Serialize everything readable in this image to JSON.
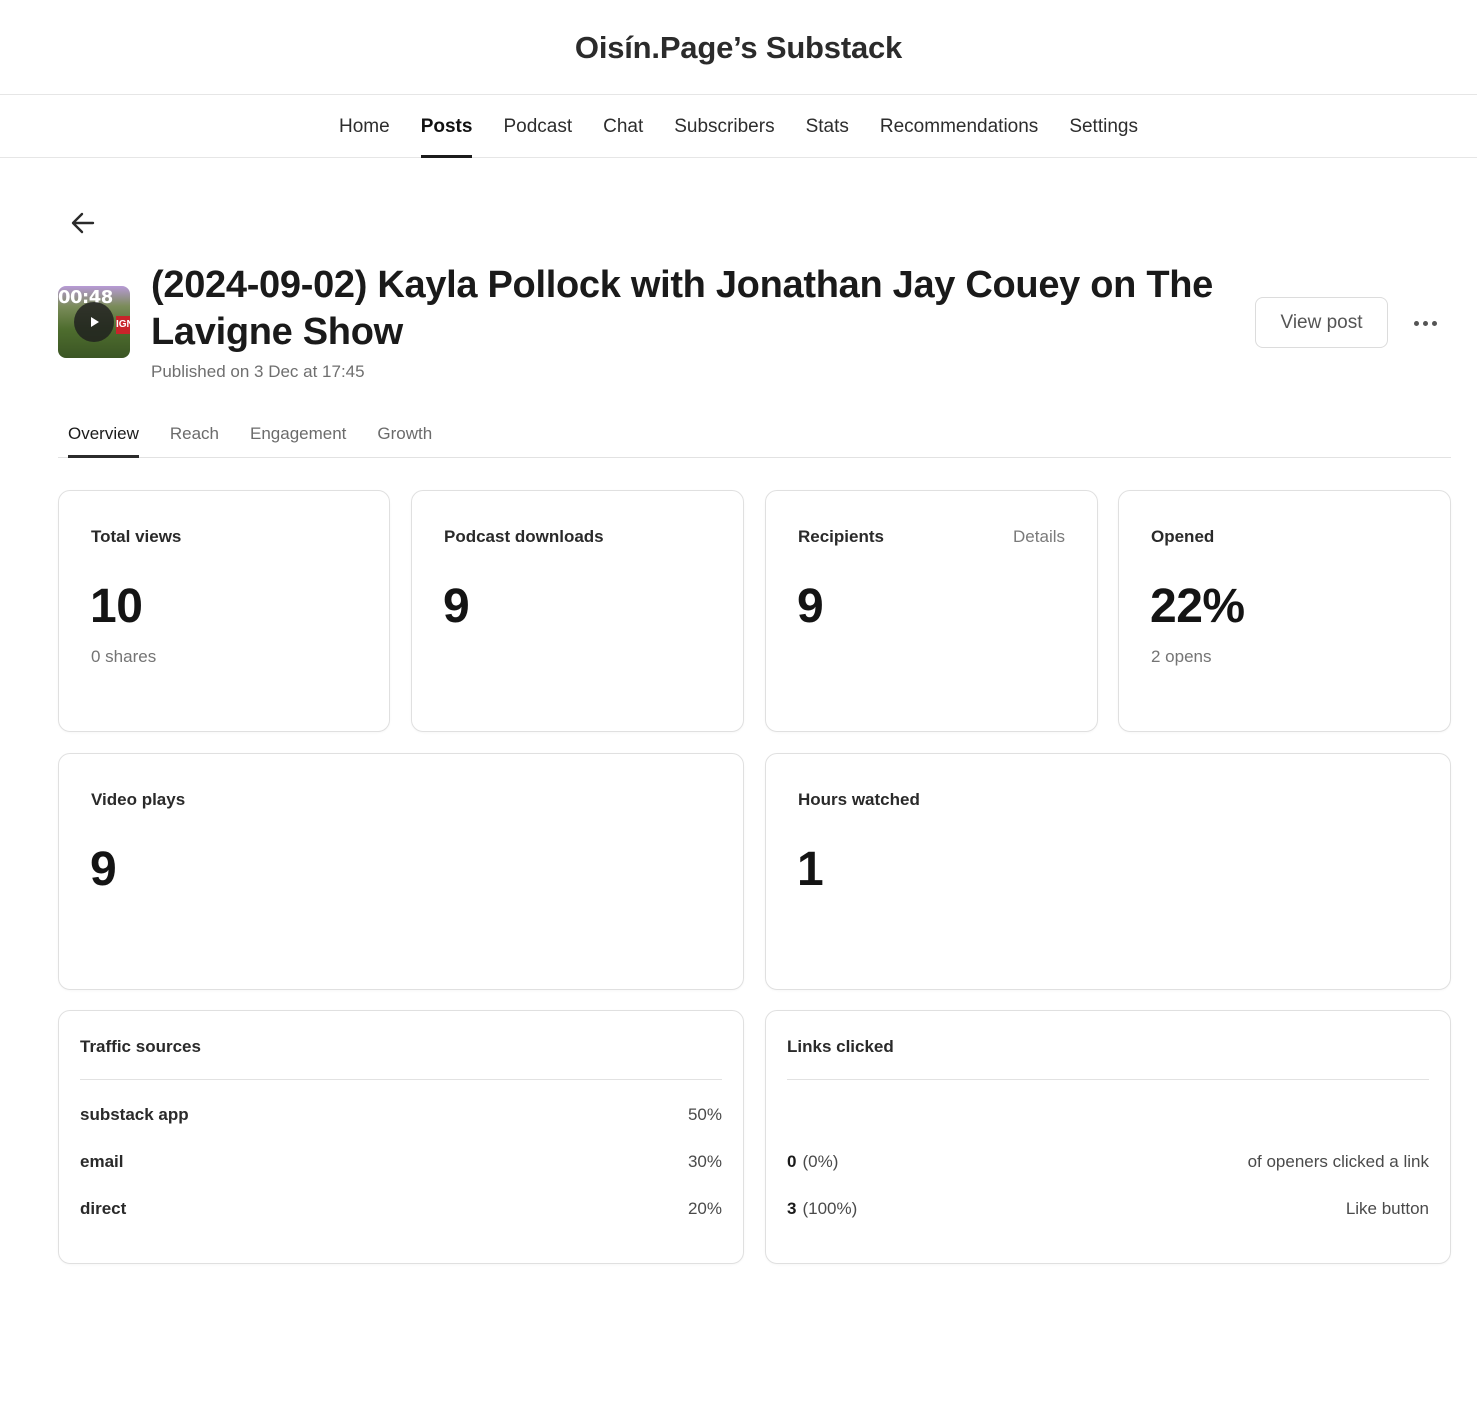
{
  "site": {
    "title": "Oisín.Page’s Substack"
  },
  "nav": {
    "items": [
      {
        "label": "Home"
      },
      {
        "label": "Posts"
      },
      {
        "label": "Podcast"
      },
      {
        "label": "Chat"
      },
      {
        "label": "Subscribers"
      },
      {
        "label": "Stats"
      },
      {
        "label": "Recommendations"
      },
      {
        "label": "Settings"
      }
    ],
    "active": "Posts"
  },
  "post": {
    "thumbnail_time": "00:48",
    "thumbnail_badge": "IGN",
    "title": "(2024-09-02) Kayla Pollock with Jonathan Jay Couey on The Lavigne Show",
    "published": "Published on 3 Dec at 17:45",
    "view_post_label": "View post"
  },
  "tabs": {
    "items": [
      {
        "label": "Overview"
      },
      {
        "label": "Reach"
      },
      {
        "label": "Engagement"
      },
      {
        "label": "Growth"
      }
    ],
    "active": "Overview"
  },
  "stats": {
    "total_views": {
      "label": "Total views",
      "value": "10",
      "sub": "0 shares"
    },
    "podcast_downloads": {
      "label": "Podcast downloads",
      "value": "9"
    },
    "recipients": {
      "label": "Recipients",
      "value": "9",
      "link": "Details"
    },
    "opened": {
      "label": "Opened",
      "value": "22%",
      "sub": "2 opens"
    },
    "video_plays": {
      "label": "Video plays",
      "value": "9"
    },
    "hours_watched": {
      "label": "Hours watched",
      "value": "1"
    }
  },
  "traffic_sources": {
    "title": "Traffic sources",
    "rows": [
      {
        "name": "substack app",
        "value": "50%"
      },
      {
        "name": "email",
        "value": "30%"
      },
      {
        "name": "direct",
        "value": "20%"
      }
    ]
  },
  "links_clicked": {
    "title": "Links clicked",
    "rows": [
      {
        "count": "0",
        "pct": "(0%)",
        "desc": "of openers clicked a link"
      },
      {
        "count": "3",
        "pct": "(100%)",
        "desc": "Like button"
      }
    ]
  },
  "colors": {
    "text": "#1b1b1b",
    "muted": "#747474",
    "border": "#e0e0e0",
    "accent": "#1b1b1b"
  },
  "icons": {
    "back": "arrow-left-icon",
    "play": "play-icon",
    "more": "more-horizontal-icon"
  }
}
